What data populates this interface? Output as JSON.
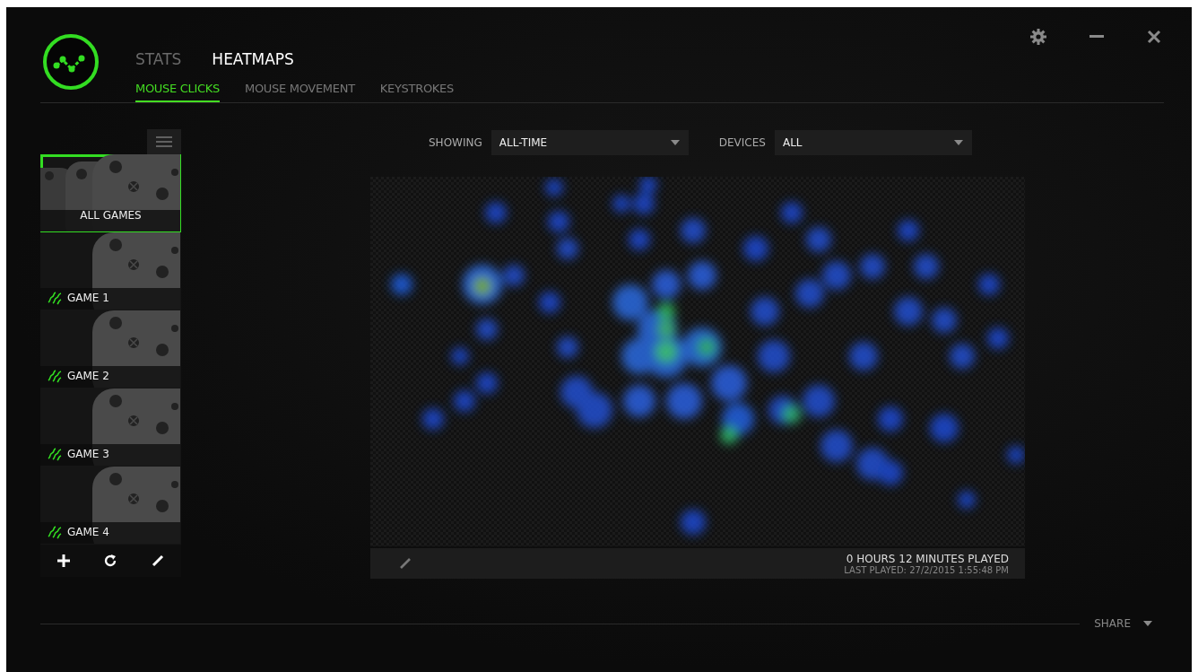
{
  "nav_tabs": [
    {
      "label": "STATS",
      "selected": false
    },
    {
      "label": "HEATMAPS",
      "selected": true
    }
  ],
  "sub_tabs": [
    {
      "label": "MOUSE CLICKS",
      "selected": true
    },
    {
      "label": "MOUSE MOVEMENT",
      "selected": false
    },
    {
      "label": "KEYSTROKES",
      "selected": false
    }
  ],
  "games": [
    {
      "label": "ALL GAMES",
      "kind": "all",
      "selected": true
    },
    {
      "label": "GAME 1",
      "kind": "game",
      "selected": false
    },
    {
      "label": "GAME 2",
      "kind": "game",
      "selected": false
    },
    {
      "label": "GAME 3",
      "kind": "game",
      "selected": false
    },
    {
      "label": "GAME 4",
      "kind": "game",
      "selected": false
    }
  ],
  "filters": [
    {
      "label": "SHOWING",
      "value": "ALL-TIME"
    },
    {
      "label": "DEVICES",
      "value": "ALL"
    }
  ],
  "heatmap_footer": {
    "playtime": "0 HOURS 12 MINUTES PLAYED",
    "last_played": "LAST PLAYED: 27/2/2015 1:55:48 PM"
  },
  "share": "SHARE"
}
